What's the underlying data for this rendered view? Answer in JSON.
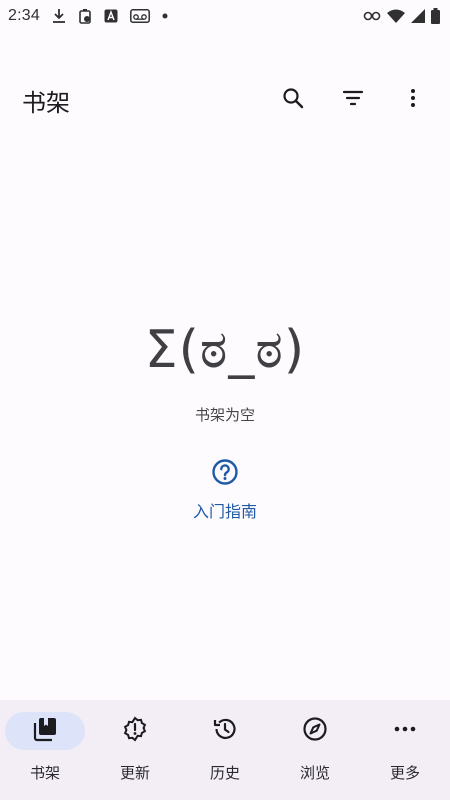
{
  "status_bar": {
    "time": "2:34",
    "icons_left": [
      "download-icon",
      "battery-saver-icon",
      "a-letter-icon",
      "voicemail-icon",
      "dot-icon"
    ],
    "icons_right": [
      "key-icon",
      "wifi-icon",
      "signal-icon",
      "battery-icon"
    ]
  },
  "top_bar": {
    "title": "书架",
    "actions": [
      "search-icon",
      "filter-icon",
      "more-vert-icon"
    ]
  },
  "empty_state": {
    "kaomoji": "Σ(ಠ_ಠ)",
    "message": "书架为空"
  },
  "guide": {
    "icon": "help-circle-icon",
    "label": "入门指南"
  },
  "bottom_nav": {
    "items": [
      {
        "label": "书架",
        "icon": "library-icon",
        "active": true
      },
      {
        "label": "更新",
        "icon": "updates-badge-icon",
        "active": false
      },
      {
        "label": "历史",
        "icon": "history-icon",
        "active": false
      },
      {
        "label": "浏览",
        "icon": "compass-icon",
        "active": false
      },
      {
        "label": "更多",
        "icon": "more-horiz-icon",
        "active": false
      }
    ]
  },
  "colors": {
    "background": "#fdfbfe",
    "nav_background": "#f3edf5",
    "nav_active_indicator": "#dde3f8",
    "accent_link": "#1f5aa6"
  }
}
